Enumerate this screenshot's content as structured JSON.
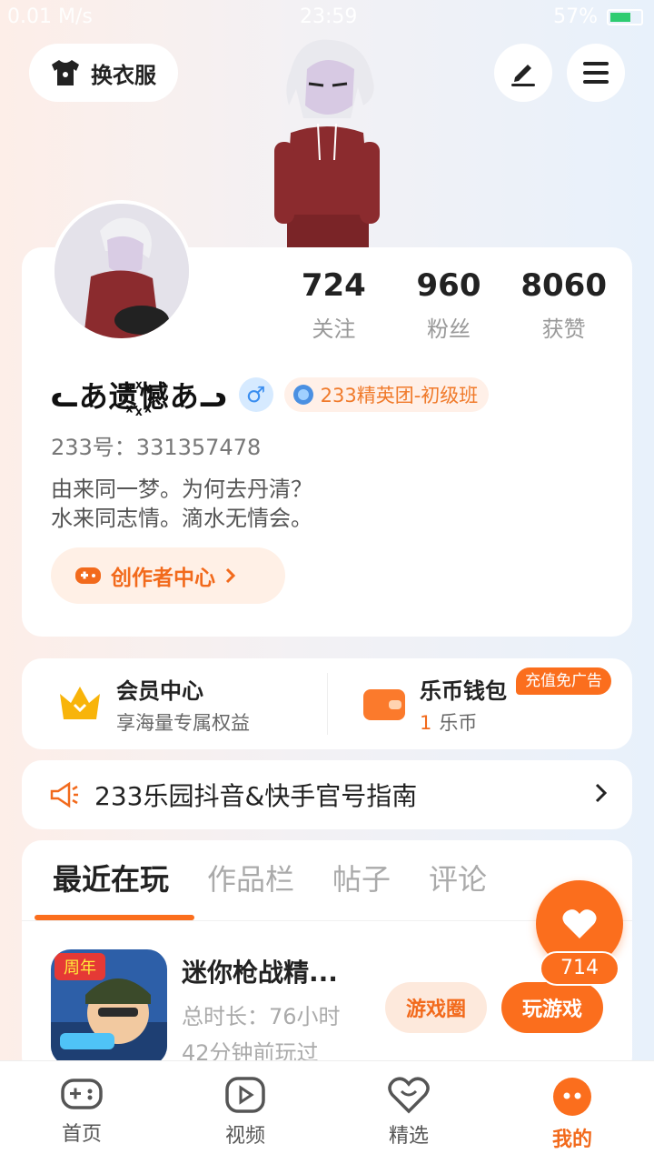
{
  "status_bar": {
    "left": "0.01 M/s",
    "time": "23:59",
    "battery": "57%"
  },
  "top": {
    "outfit_label": "换衣服",
    "edit_icon": "pencil-icon",
    "menu_icon": "menu-icon"
  },
  "profile": {
    "stats": [
      {
        "value": "724",
        "label": "关注"
      },
      {
        "value": "960",
        "label": "粉丝"
      },
      {
        "value": "8060",
        "label": "获赞"
      }
    ],
    "nickname": "ᓚあ遗꙰憾あᓗ",
    "gender_symbol": "♂",
    "badge_text": "233精英团-初级班",
    "uid": "233号：331357478",
    "bio_line1": "由来同一梦。为何去丹清？",
    "bio_line2": "水来同志情。滴水无情会。",
    "creator_label": "创作者中心"
  },
  "member": {
    "title": "会员中心",
    "subtitle": "享海量专属权益"
  },
  "wallet": {
    "title": "乐币钱包",
    "amount": "1",
    "unit": "乐币",
    "promo": "充值免广告"
  },
  "guide": {
    "text": "233乐园抖音&快手官号指南"
  },
  "recent": {
    "tabs": [
      {
        "label": "最近在玩"
      },
      {
        "label": "作品栏"
      },
      {
        "label": "帖子"
      },
      {
        "label": "评论"
      }
    ],
    "game": {
      "title": "迷你枪战精...",
      "duration": "总时长：76小时",
      "last_played": "42分钟前玩过",
      "icon_text": "周年",
      "circle_btn": "游戏圈",
      "play_btn": "玩游戏"
    }
  },
  "like": {
    "count": "714"
  },
  "nav": [
    {
      "label": "首页",
      "icon": "gamepad-icon"
    },
    {
      "label": "视频",
      "icon": "play-icon"
    },
    {
      "label": "精选",
      "icon": "heart-chat-icon"
    },
    {
      "label": "我的",
      "icon": "face-icon"
    }
  ],
  "colors": {
    "accent": "#fb6e1d",
    "accent_text": "#f26a1c"
  }
}
